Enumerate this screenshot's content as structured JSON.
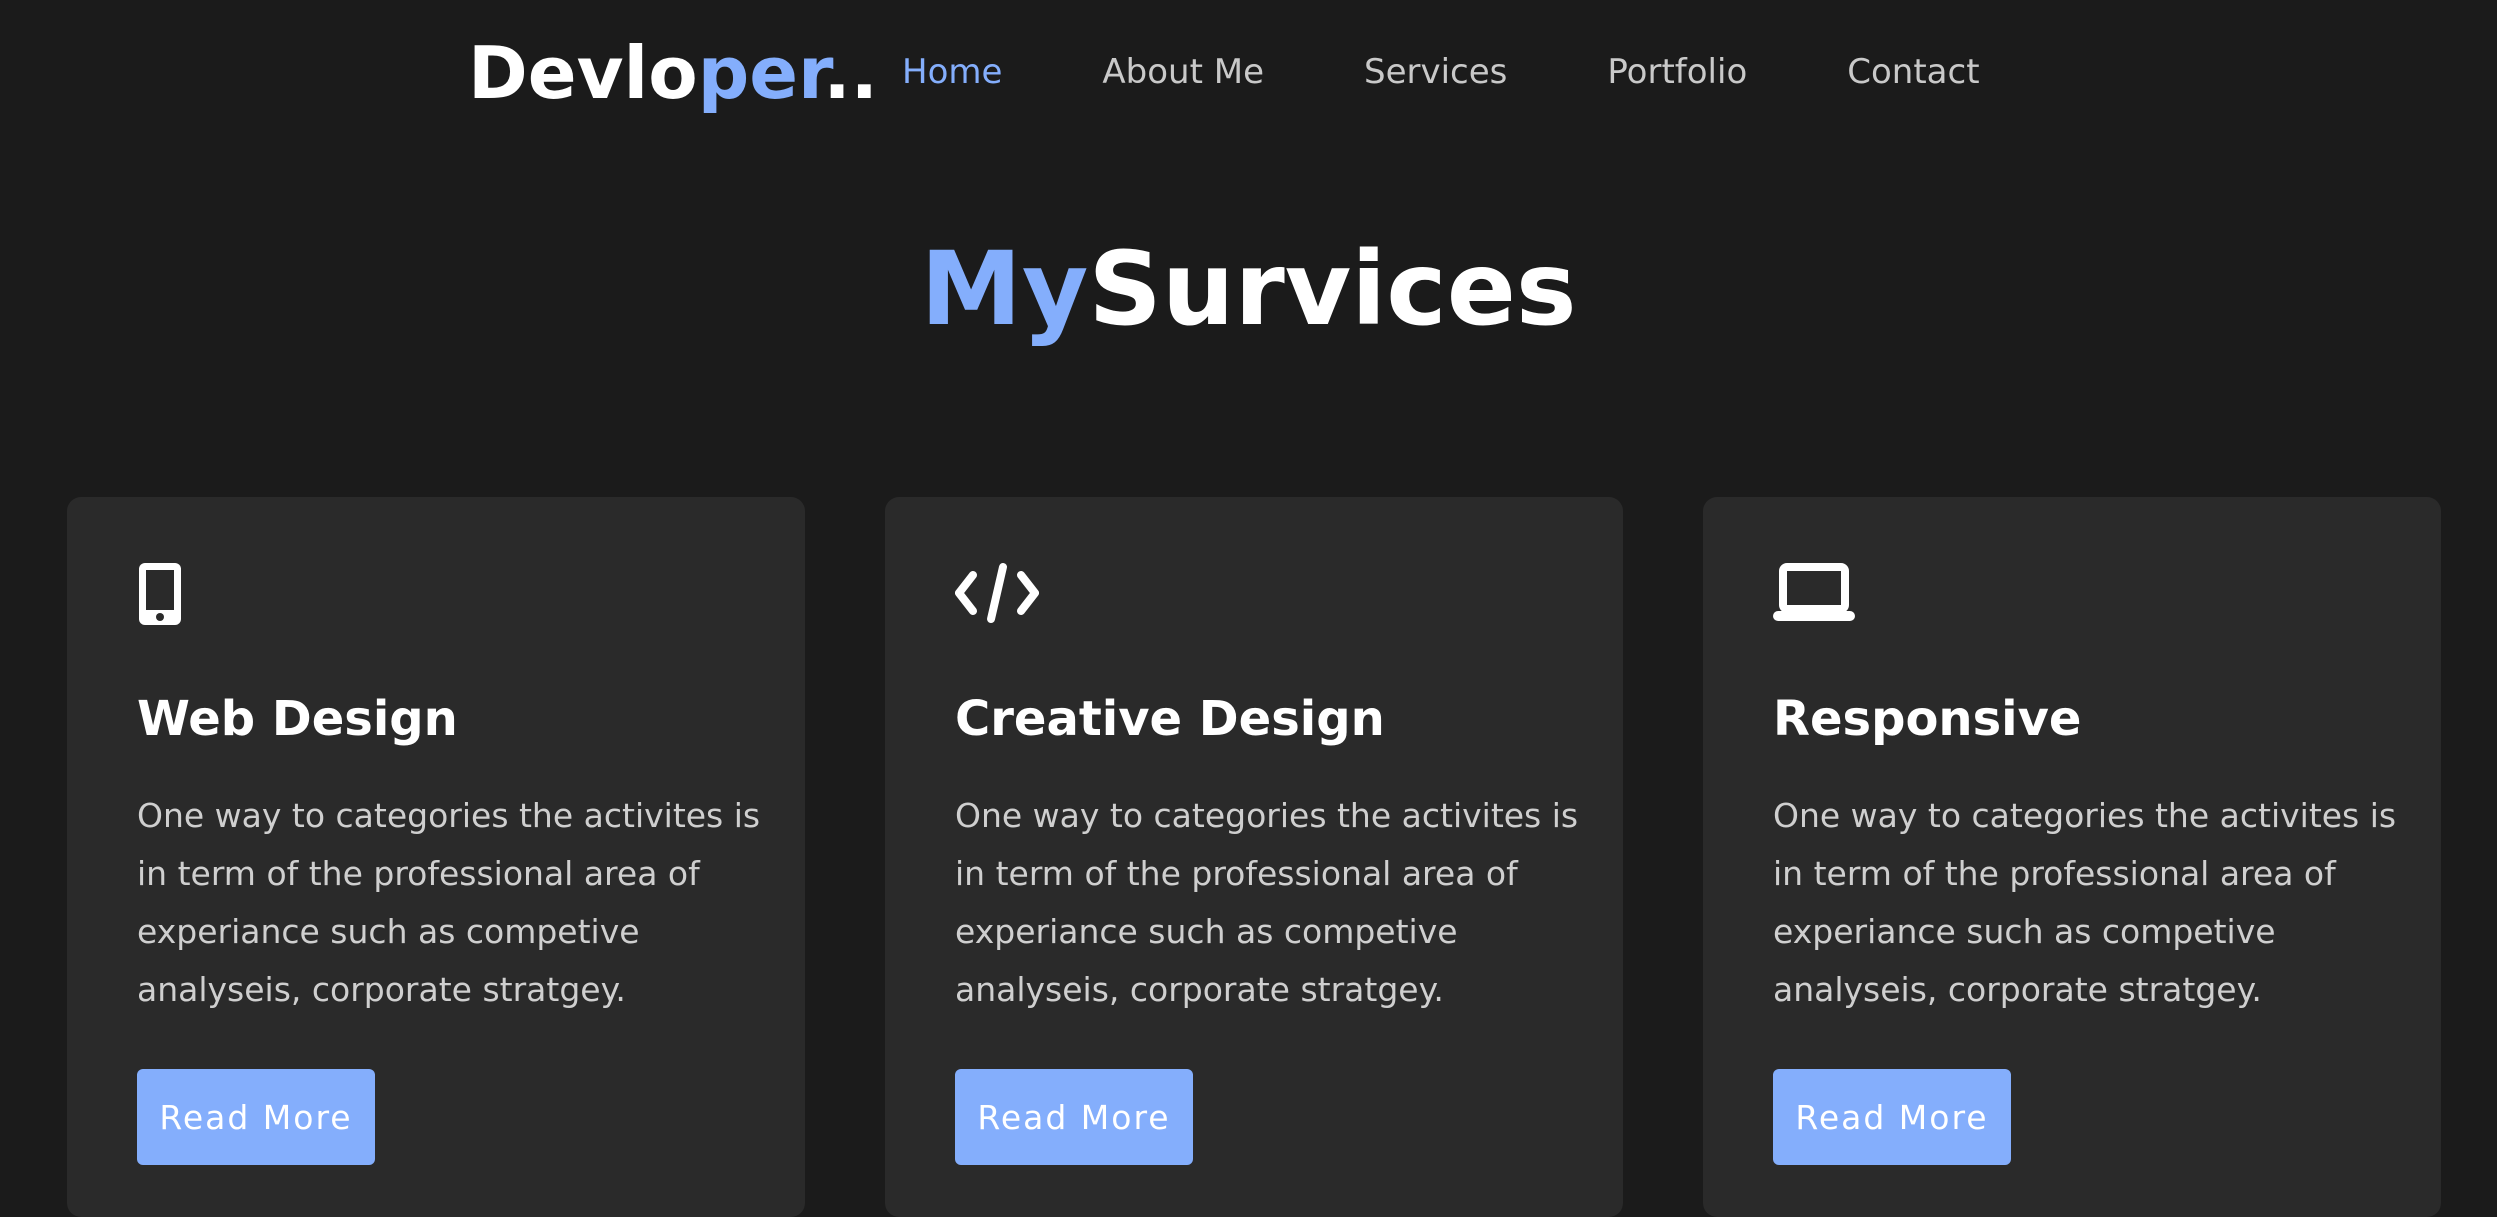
{
  "navbar": {
    "logo_start": "Devlo",
    "logo_accent": "per",
    "logo_end": "..",
    "links": [
      {
        "label": "Home",
        "active": true
      },
      {
        "label": "About Me",
        "active": false
      },
      {
        "label": "Services",
        "active": false
      },
      {
        "label": "Portfolio",
        "active": false
      },
      {
        "label": "Contact",
        "active": false
      }
    ]
  },
  "heading": {
    "accent": "My",
    "main": "Survices"
  },
  "cards": [
    {
      "icon": "mobile-icon",
      "title": "Web Design",
      "text": "One way to categories the activites is in term of the professional area of experiance such as competive analyseis, corporate stratgey.",
      "button": "Read More"
    },
    {
      "icon": "code-icon",
      "title": "Creative Design",
      "text": "One way to categories the activites is in term of the professional area of experiance such as competive analyseis, corporate stratgey.",
      "button": "Read More"
    },
    {
      "icon": "laptop-icon",
      "title": "Responsive",
      "text": "One way to categories the activites is in term of the professional area of experiance such as competive analyseis, corporate stratgey.",
      "button": "Read More"
    }
  ],
  "colors": {
    "background": "#1b1b1b",
    "card": "#2a2a2a",
    "accent": "#84aefc",
    "text": "#ffffff",
    "muted": "#cfcfcf"
  }
}
